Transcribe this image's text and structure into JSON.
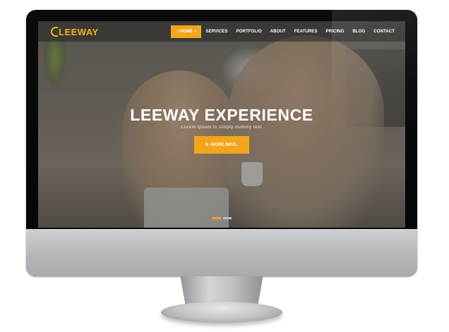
{
  "site": {
    "logo_text": "LEEWAY",
    "nav": {
      "items": [
        {
          "label": "HOME",
          "active": true,
          "icon": "home-icon",
          "has_dropdown": true
        },
        {
          "label": "SERVICES"
        },
        {
          "label": "PORTFOLIO"
        },
        {
          "label": "ABOUT"
        },
        {
          "label": "FEATURES"
        },
        {
          "label": "PRICING"
        },
        {
          "label": "BLOG"
        },
        {
          "label": "CONTACT"
        }
      ]
    },
    "hero": {
      "title": "LEEWAY EXPERIENCE",
      "subtitle": "Lorem Ipsum is simply dummy text",
      "button_label": "MORE INFO..",
      "button_icon": "edit-icon",
      "slides": 2,
      "active_slide": 1
    },
    "colors": {
      "accent": "#f3a51b",
      "logo": "#f3b21b"
    }
  }
}
